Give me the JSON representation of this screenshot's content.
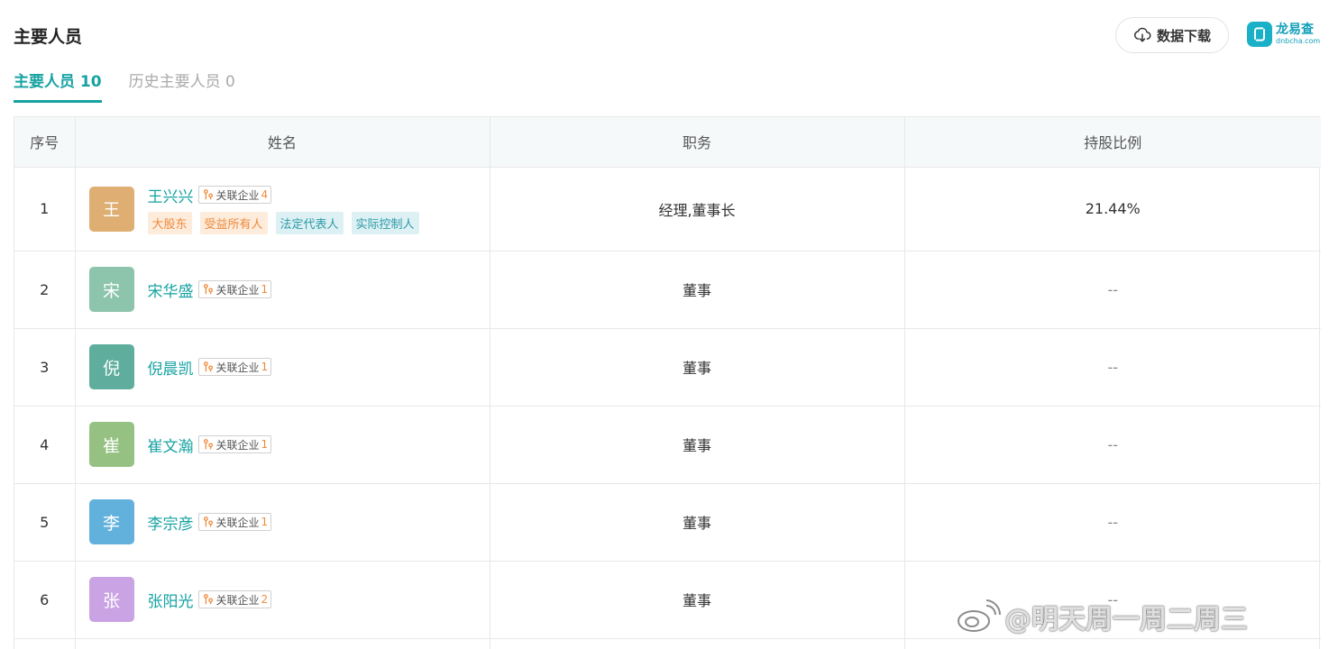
{
  "page_title": "主要人员",
  "download_label": "数据下载",
  "logo": {
    "main": "龙易查",
    "sub": "dnbcha.com"
  },
  "tabs": [
    {
      "label": "主要人员 10",
      "active": true
    },
    {
      "label": "历史主要人员 0",
      "active": false
    }
  ],
  "columns": [
    "序号",
    "姓名",
    "职务",
    "持股比例"
  ],
  "rel_label": "关联企业",
  "rows": [
    {
      "no": "1",
      "avatar": "王",
      "avatar_color": "#dfae72",
      "name": "王兴兴",
      "rel_count": "4",
      "tags": [
        "大股东",
        "受益所有人",
        "法定代表人",
        "实际控制人"
      ],
      "position": "经理,董事长",
      "share": "21.44%"
    },
    {
      "no": "2",
      "avatar": "宋",
      "avatar_color": "#8cc4ac",
      "name": "宋华盛",
      "rel_count": "1",
      "tags": [],
      "position": "董事",
      "share": "--"
    },
    {
      "no": "3",
      "avatar": "倪",
      "avatar_color": "#5fae9d",
      "name": "倪晨凯",
      "rel_count": "1",
      "tags": [],
      "position": "董事",
      "share": "--"
    },
    {
      "no": "4",
      "avatar": "崔",
      "avatar_color": "#95c282",
      "name": "崔文瀚",
      "rel_count": "1",
      "tags": [],
      "position": "董事",
      "share": "--"
    },
    {
      "no": "5",
      "avatar": "李",
      "avatar_color": "#62b1dc",
      "name": "李宗彦",
      "rel_count": "1",
      "tags": [],
      "position": "董事",
      "share": "--"
    },
    {
      "no": "6",
      "avatar": "张",
      "avatar_color": "#c9a3e3",
      "name": "张阳光",
      "rel_count": "2",
      "tags": [],
      "position": "董事",
      "share": "--"
    }
  ],
  "watermark": "@明天周一周二周三"
}
